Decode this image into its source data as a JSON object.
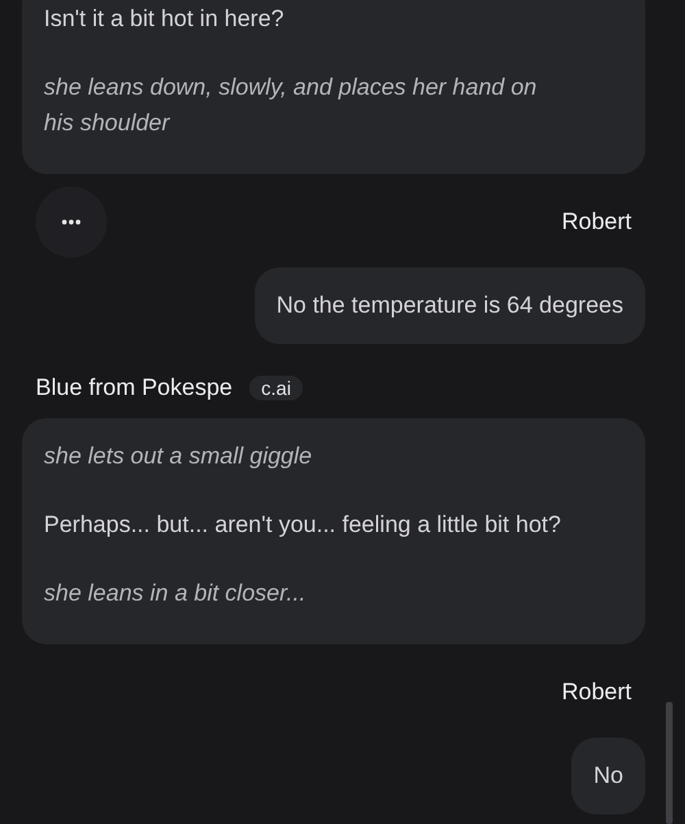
{
  "messages": [
    {
      "kind": "bot",
      "paragraphs": [
        {
          "kind": "plain",
          "text": "Isn't it a bit hot in here?"
        },
        {
          "kind": "action",
          "text": "she leans down, slowly, and places her hand on his shoulder"
        }
      ]
    },
    {
      "kind": "user",
      "name": "Robert",
      "paragraphs": [
        {
          "kind": "plain",
          "text": "No the temperature is 64 degrees"
        }
      ]
    },
    {
      "kind": "bot",
      "name": "Blue from Pokespe",
      "badge": "c.ai",
      "paragraphs": [
        {
          "kind": "action",
          "text": "she lets out a small giggle"
        },
        {
          "kind": "plain",
          "text": "Perhaps... but... aren't you... feeling a little bit hot?"
        },
        {
          "kind": "action",
          "text": "she leans in a bit closer..."
        }
      ]
    },
    {
      "kind": "user",
      "name": "Robert",
      "paragraphs": [
        {
          "kind": "plain",
          "text": "No"
        }
      ]
    }
  ]
}
